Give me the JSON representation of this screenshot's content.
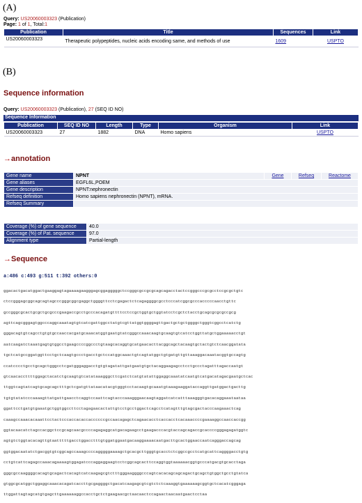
{
  "panelA": {
    "label": "(A)",
    "query_label": "Query:",
    "query_id": "US20060003323",
    "query_type": "(Publication)",
    "page_label": "Page:",
    "page_current": "1",
    "page_of": "of",
    "page_total": "1",
    "total_label": ", Total:",
    "total_value": "1",
    "headers": [
      "Publication",
      "Title",
      "Sequences",
      "Link"
    ],
    "row": {
      "publication": "US20060003323",
      "title": "Therapeutic polypeptides, nucleic acids encoding same, and methods of use",
      "sequences": "1609",
      "link": "USPTO"
    }
  },
  "panelB": {
    "label": "(B)",
    "section_title": "Sequence information",
    "query_label": "Query:",
    "query_id": "US20060003323",
    "query_type": "(Publication),",
    "seq_no": "27",
    "seq_no_suffix": "(SEQ ID NO)",
    "bar_title": "Sequence Information",
    "headers": [
      "Publication",
      "SEQ ID NO",
      "Length",
      "Type",
      "Organism",
      "Link"
    ],
    "row": {
      "publication": "US20060003323",
      "seq_id": "27",
      "length": "1882",
      "type": "DNA",
      "organism": "Homo sapiens",
      "link": "USPTO"
    }
  },
  "annotation": {
    "title": "annotation",
    "rows": [
      {
        "key": "Gene name",
        "value": "NPNT"
      },
      {
        "key": "Gene aliases",
        "value": "EGFL6L,POEM"
      },
      {
        "key": "Gene description",
        "value": "NPNT:nephronectin"
      },
      {
        "key": "Refseq definition",
        "value": "Homo sapiens nephronectin (NPNT), mRNA."
      },
      {
        "key": "Refseq Summary",
        "value": ""
      }
    ],
    "links": [
      "Gene",
      "Refseq",
      "Reactome"
    ],
    "coverage": [
      {
        "key": "Coverage (%) of gene sequence",
        "value": "40.0"
      },
      {
        "key": "Coverage (%) of Pat. sequence",
        "value": "97.0"
      },
      {
        "key": "Alignment type",
        "value": "Partial-length"
      }
    ]
  },
  "sequence": {
    "title": "Sequence",
    "counts": "a:486  c:493  g:511  t:392  others:0",
    "lines": [
      "ggacactgacatggactgaaggagtagaaaagaagggagcggagggggctccgggcgccgcgcagcagacctactccgggcccgcgcctccgcgctgtc",
      "ctccgggagcggcagcagtagcccgggcggcgaggctggggttcctcgagactctcagaggggcgcctcccatcggcgcccacccccaacctgttc",
      "gccgggcgcactgcgctgcgcccgaagaccgcctgcccacagatgttttcctccgctggtgctggtatcctcgctctacctgcagcgcgcgccgcg",
      "agttcagcgggagtggcccaggcaaatagtgtcatcgattggcctatgtcgttatggtggggagttgactgctgctggggctgggtcggcctcatctg",
      "gggacagtgtcagcctgtgtgccaaccacgatgcaaacatggtgaatgtatcgggccaaacaagtgcaagtgtcatcctggttatgctggaaaaacctgt",
      "aatcaagatctaaatgagtgtggcctgaagccccggccctgtaagcacaggtgcatgaacacttacggcagctacaagtgctactgtctcaacggatata",
      "tgctcatgccggatggttcctgctcaagtgccctgacctgctccatggcaaactgtcagtatggctgtgatgttgttaaaggacaaatacggtgccagtg",
      "ccatcccctgcctgcagctgggcctcgatgggaggacctgtgtagatattgatgaatgtgctacaggaagagcctcctgccctagatttagaccaatgt",
      "gtcaacaccttttggagctacatctgcaagtgtcatataaagggcttcgatctcatgtatattggaggcaaatatcaatgtcatgacatagacgaatgctcac",
      "ttggtcagtatcagtgcagcagctttgctcgatgttataacatacgtgggtcctacaagtgcaaatgtaaagaaggataccaggttgatggactgacttg",
      "tgtgtatatcccaaaagttatgattgaacctcaggtccaattcagtacccaaagggaacaagtaggatcatcatttaaagggtgacacaggaaataataa",
      "ggattcctgatgtgaaatgctggtggccttcctagagaacactattgtcctgcctggactcagcctcatagtttgtagcgactacccaagaaactcag",
      "caaagccaaacacaaattcctactcccaccacaccaccccccgccaacagagctcagaacacctcaccacctcacaaaccccgaaaaggccaaccaccgg",
      "ggtacaacatctagccacggctccgcagcaacgccccagagaggcatgacagaagcctgaagacccacgtaccagcagaccgcaccccgggagagatggtc",
      "agtgtctggtacacagttgtaatttttgacctggacctttgtggatggaatgacaaggaaaacaatgacttgcactggaaccaatcagggaccagcag",
      "ggtggacaatatctgacggtgtcggcagccaaagccccagggggaaaagctgcacgcttgggtgcacctctcggccgcctcatgcattcaggggacctgtg",
      "cctgtcattcagagccaaacagaaaagtggagatcccaggaggaagtcctcggcagcacttccaggtggtaaaaaacggtgcccatgacgtgcacctaga",
      "gggcgccaaggggcacagtgcagactcacagtcatcaagagcgtctttgggaaggggcccagtcacacagcagcagactgcagctgtggctgcctgtatca",
      "gtggcgcatggctggaggcaaacacagatcaccttgcgaggggctgacatcaagagcgtcgtctctcaaaggtgaaaaaagcggtgctcacatcgggaga",
      "ttggattagtagcatgtgagcttgaaaaaaggccacctgctctgaagaacgctaacaactccagaactaacaatgaactcctaa"
    ]
  }
}
